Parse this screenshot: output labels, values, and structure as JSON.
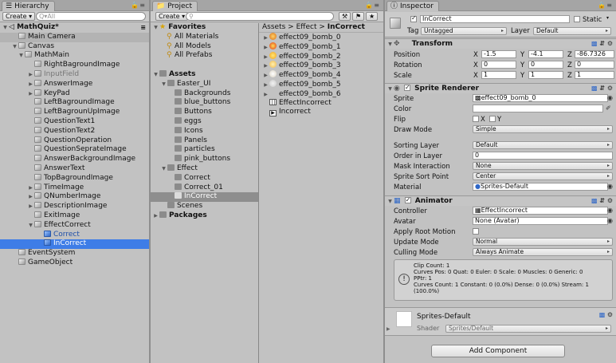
{
  "hierarchy": {
    "tab": "Hierarchy",
    "create_label": "Create",
    "search_placeholder": "Q▾All",
    "scene": "MathQuiz*",
    "items": [
      "Main Camera",
      "Canvas",
      "MathMain",
      "RightBagroundImage",
      "InputField",
      "AnswerImage",
      "KeyPad",
      "LeftBagroundImage",
      "LeftBagrounUpImage",
      "QuestionText1",
      "QuestionText2",
      "QuestionOperation",
      "QuestionSeprateImage",
      "AnswerBackgroundImage",
      "AnswerText",
      "TopBagroundImage",
      "TimeImage",
      "QNumberImage",
      "DescriptionImage",
      "ExitImage",
      "EffectCorrect",
      "Correct",
      "InCorrect",
      "EventSystem",
      "GameObject"
    ]
  },
  "project": {
    "tab": "Project",
    "create_label": "Create",
    "favorites_label": "Favorites",
    "favorites": [
      "All Materials",
      "All Models",
      "All Prefabs"
    ],
    "assets_label": "Assets",
    "folders": [
      "Easter_UI",
      "Backgrounds",
      "blue_buttons",
      "Buttons",
      "eggs",
      "Icons",
      "Panels",
      "particles",
      "pink_buttons",
      "Effect",
      "Correct",
      "Correct_01",
      "InCorrect",
      "Scenes",
      "Packages"
    ],
    "breadcrumb": [
      "Assets",
      "Effect",
      "InCorrect"
    ],
    "breadcrumb_sep": ">",
    "files": [
      "effect09_bomb_0",
      "effect09_bomb_1",
      "effect09_bomb_2",
      "effect09_bomb_3",
      "effect09_bomb_4",
      "effect09_bomb_5",
      "effect09_bomb_6",
      "EffectIncorrect",
      "Incorrect"
    ]
  },
  "inspector": {
    "tab": "Inspector",
    "object_name": "InCorrect",
    "static_label": "Static",
    "tag_label": "Tag",
    "tag_value": "Untagged",
    "layer_label": "Layer",
    "layer_value": "Default",
    "transform": {
      "title": "Transform",
      "position_label": "Position",
      "rotation_label": "Rotation",
      "scale_label": "Scale",
      "axis_x": "X",
      "axis_y": "Y",
      "axis_z": "Z",
      "position": [
        "-1.5",
        "-4.1",
        "-86.7326"
      ],
      "rotation": [
        "0",
        "0",
        "0"
      ],
      "scale": [
        "1",
        "1",
        "1"
      ]
    },
    "sprite_renderer": {
      "title": "Sprite Renderer",
      "sprite_label": "Sprite",
      "sprite_value": "effect09_bomb_0",
      "color_label": "Color",
      "flip_label": "Flip",
      "flip_x": "X",
      "flip_y": "Y",
      "draw_mode_label": "Draw Mode",
      "draw_mode_value": "Simple",
      "sorting_layer_label": "Sorting Layer",
      "sorting_layer_value": "Default",
      "order_label": "Order in Layer",
      "order_value": "0",
      "mask_label": "Mask Interaction",
      "mask_value": "None",
      "sort_point_label": "Sprite Sort Point",
      "sort_point_value": "Center",
      "material_label": "Material",
      "material_value": "Sprites-Default"
    },
    "animator": {
      "title": "Animator",
      "controller_label": "Controller",
      "controller_value": "EffectIncorrect",
      "avatar_label": "Avatar",
      "avatar_value": "None (Avatar)",
      "root_motion_label": "Apply Root Motion",
      "update_mode_label": "Update Mode",
      "update_mode_value": "Normal",
      "culling_label": "Culling Mode",
      "culling_value": "Always Animate",
      "info_lines": [
        "Clip Count: 1",
        "Curves Pos: 0 Quat: 0 Euler: 0 Scale: 0 Muscles: 0 Generic: 0",
        "PPtr: 1",
        "Curves Count: 1 Constant: 0 (0.0%) Dense: 0 (0.0%) Stream: 1",
        "(100.0%)"
      ]
    },
    "material": {
      "name": "Sprites-Default",
      "shader_label": "Shader",
      "shader_value": "Sprites/Default"
    },
    "add_component_label": "Add Component"
  },
  "colors": {
    "selection": "#3e7de7",
    "panel": "#c2c2c2",
    "accent_blue": "#2f67c7"
  },
  "icons": [
    "hierarchy-icon",
    "project-icon",
    "info-icon",
    "lock-icon",
    "menu-icon",
    "cube-icon",
    "folder-icon",
    "star-icon",
    "gear-icon",
    "help-icon",
    "warning-icon"
  ]
}
